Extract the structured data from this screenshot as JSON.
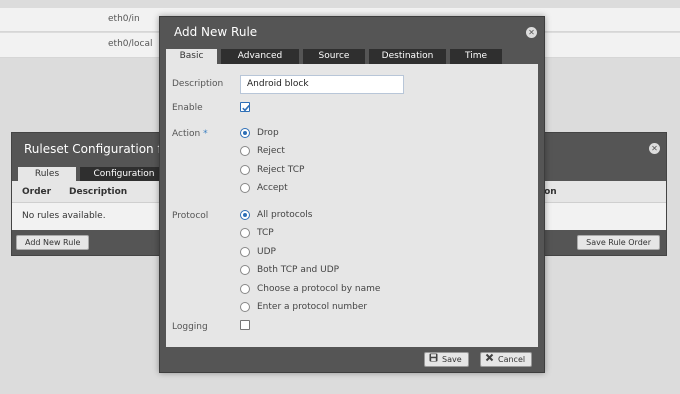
{
  "background": {
    "interfaces": [
      "eth0/in",
      "eth0/local"
    ]
  },
  "ruleset": {
    "title": "Ruleset Configuration for",
    "tabs": [
      "Rules",
      "Configuration"
    ],
    "columns": [
      "Order",
      "Description",
      "ion"
    ],
    "empty_text": "No rules available.",
    "add_button": "Add New Rule",
    "save_order_button": "Save Rule Order"
  },
  "modal": {
    "title": "Add New Rule",
    "tabs": [
      "Basic",
      "Advanced",
      "Source",
      "Destination",
      "Time"
    ],
    "active_tab": "Basic",
    "description_label": "Description",
    "description_value": "Android block",
    "enable_label": "Enable",
    "enable_checked": true,
    "action_label": "Action",
    "required_mark": "*",
    "actions": [
      "Drop",
      "Reject",
      "Reject TCP",
      "Accept"
    ],
    "action_selected": "Drop",
    "protocol_label": "Protocol",
    "protocols": [
      "All protocols",
      "TCP",
      "UDP",
      "Both TCP and UDP",
      "Choose a protocol by name",
      "Enter a protocol number"
    ],
    "protocol_selected": "All protocols",
    "logging_label": "Logging",
    "logging_checked": false,
    "save_button": "Save",
    "cancel_button": "Cancel"
  },
  "colors": {
    "accent": "#2e6fb7",
    "dark_panel": "#555555",
    "tab_dark": "#2f2f2f",
    "body_light": "#e6e6e6"
  }
}
